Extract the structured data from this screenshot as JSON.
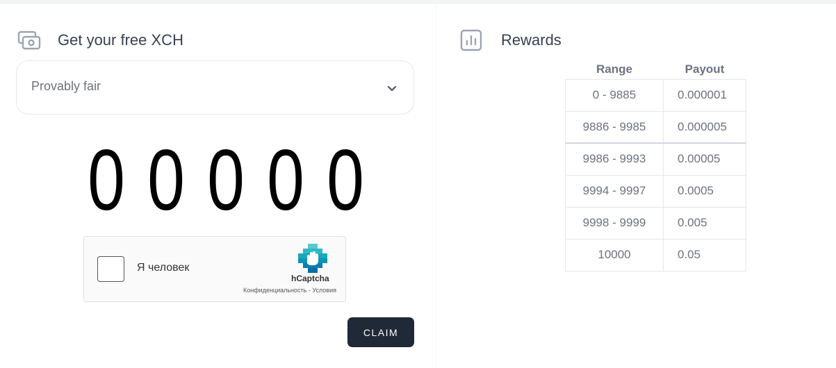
{
  "faucet": {
    "icon": "cash-icon",
    "title": "Get your free XCH",
    "select": {
      "value": "Provably fair",
      "icon": "chevron-down-icon"
    },
    "roll_digits": [
      "0",
      "0",
      "0",
      "0",
      "0"
    ],
    "captcha": {
      "checkbox_label": "Я человек",
      "brand": "hCaptcha",
      "links": "Конфиденциальность - Условия"
    },
    "claim_label": "CLAIM"
  },
  "rewards": {
    "icon": "bar-chart-icon",
    "title": "Rewards",
    "headers": [
      "Range",
      "Payout"
    ],
    "rows": [
      {
        "range": "0 - 9885",
        "payout": "0.000001"
      },
      {
        "range": "9886 - 9985",
        "payout": "0.000005"
      },
      {
        "range": "9986 - 9993",
        "payout": "0.00005"
      },
      {
        "range": "9994 - 9997",
        "payout": "0.0005"
      },
      {
        "range": "9998 - 9999",
        "payout": "0.005"
      },
      {
        "range": "10000",
        "payout": "0.05"
      }
    ]
  },
  "colors": {
    "background": "#f3f4f6",
    "panel": "#ffffff",
    "button": "#1f2937",
    "text": "#374151",
    "muted": "#6b7280"
  }
}
